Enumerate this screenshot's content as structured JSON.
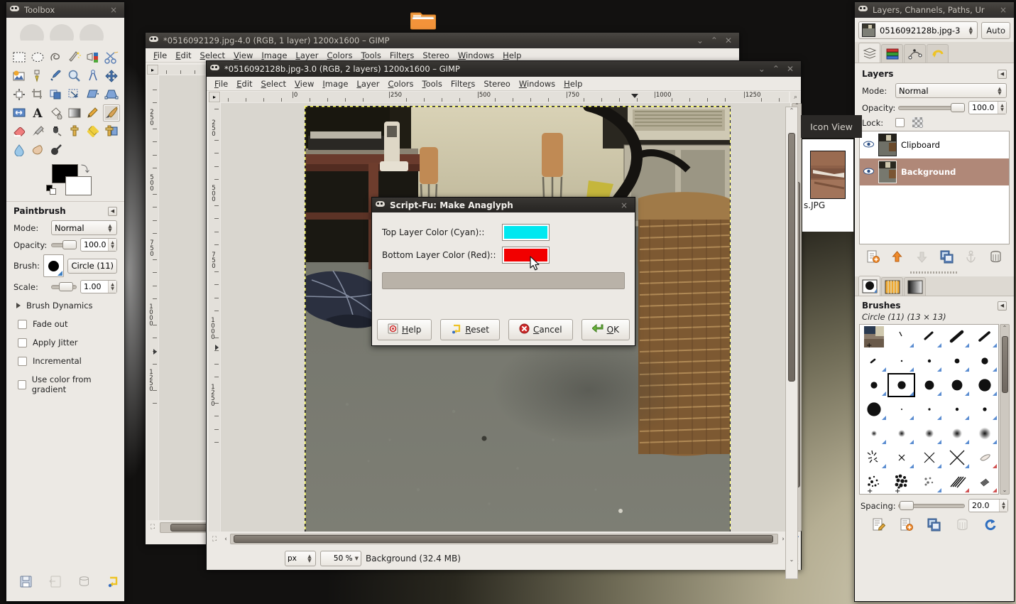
{
  "desktop": {
    "folder_icon": "folder-icon"
  },
  "toolbox": {
    "title": "Toolbox",
    "close_label": "×",
    "tools": [
      {
        "name": "rect-select-tool",
        "glyph": "rect-select"
      },
      {
        "name": "ellipse-select-tool",
        "glyph": "ellipse-select"
      },
      {
        "name": "free-select-tool",
        "glyph": "lasso"
      },
      {
        "name": "fuzzy-select-tool",
        "glyph": "wand"
      },
      {
        "name": "select-by-color-tool",
        "glyph": "bycolor"
      },
      {
        "name": "scissors-select-tool",
        "glyph": "scissors"
      },
      {
        "name": "foreground-select-tool",
        "glyph": "fgselect"
      },
      {
        "name": "paths-tool",
        "glyph": "path"
      },
      {
        "name": "color-picker-tool",
        "glyph": "picker"
      },
      {
        "name": "zoom-tool",
        "glyph": "zoom"
      },
      {
        "name": "measure-tool",
        "glyph": "measure"
      },
      {
        "name": "move-tool",
        "glyph": "move"
      },
      {
        "name": "alignment-tool",
        "glyph": "align"
      },
      {
        "name": "crop-tool",
        "glyph": "crop"
      },
      {
        "name": "rotate-tool",
        "glyph": "rotate"
      },
      {
        "name": "scale-tool",
        "glyph": "scale"
      },
      {
        "name": "shear-tool",
        "glyph": "shear"
      },
      {
        "name": "perspective-tool",
        "glyph": "perspective"
      },
      {
        "name": "flip-tool",
        "glyph": "flip"
      },
      {
        "name": "text-tool",
        "glyph": "text"
      },
      {
        "name": "bucket-fill-tool",
        "glyph": "bucket"
      },
      {
        "name": "gradient-tool",
        "glyph": "gradient"
      },
      {
        "name": "pencil-tool",
        "glyph": "pencil"
      },
      {
        "name": "paintbrush-tool",
        "glyph": "paintbrush",
        "selected": true
      },
      {
        "name": "eraser-tool",
        "glyph": "eraser"
      },
      {
        "name": "airbrush-tool",
        "glyph": "airbrush"
      },
      {
        "name": "ink-tool",
        "glyph": "ink"
      },
      {
        "name": "clone-tool",
        "glyph": "clone"
      },
      {
        "name": "heal-tool",
        "glyph": "heal"
      },
      {
        "name": "perspective-clone-tool",
        "glyph": "pclone"
      },
      {
        "name": "blur-sharpen-tool",
        "glyph": "blur"
      },
      {
        "name": "smudge-tool",
        "glyph": "smudge"
      },
      {
        "name": "dodge-burn-tool",
        "glyph": "dodge"
      }
    ],
    "colors": {
      "foreground": "#000000",
      "background": "#ffffff"
    },
    "options": {
      "header": "Paintbrush",
      "mode_label": "Mode:",
      "mode_value": "Normal",
      "opacity_label": "Opacity:",
      "opacity_value": "100.0",
      "brush_label": "Brush:",
      "brush_value": "Circle (11)",
      "scale_label": "Scale:",
      "scale_value": "1.00",
      "brush_dynamics": "Brush Dynamics",
      "checkboxes": [
        {
          "label": "Fade out",
          "checked": false
        },
        {
          "label": "Apply Jitter",
          "checked": false
        },
        {
          "label": "Incremental",
          "checked": false
        },
        {
          "label": "Use color from gradient",
          "checked": false
        }
      ]
    },
    "bottom_icons": [
      "save-tool-options-icon",
      "restore-tool-options-icon",
      "delete-tool-options-icon",
      "reset-tool-options-icon"
    ]
  },
  "image_window_back": {
    "title": "*0516092129.jpg-4.0 (RGB, 1 layer) 1200x1600 – GIMP",
    "menus": [
      "File",
      "Edit",
      "Select",
      "View",
      "Image",
      "Layer",
      "Colors",
      "Tools",
      "Filters",
      "Stereo",
      "Windows",
      "Help"
    ],
    "v_ruler_labels": [
      "250",
      "500",
      "750",
      "1000",
      "1250"
    ]
  },
  "image_window_front": {
    "title": "*0516092128b.jpg-3.0 (RGB, 2 layers) 1200x1600 – GIMP",
    "menus": [
      "File",
      "Edit",
      "Select",
      "View",
      "Image",
      "Layer",
      "Colors",
      "Tools",
      "Filters",
      "Stereo",
      "Windows",
      "Help"
    ],
    "h_ruler_labels": [
      "0",
      "250",
      "500",
      "750",
      "1000",
      "1250"
    ],
    "v_ruler_labels": [
      "250",
      "500",
      "750",
      "1000",
      "1250"
    ],
    "statusbar": {
      "unit": "px",
      "zoom": "50 %",
      "status_text": "Background (32.4 MB)"
    }
  },
  "iconview_popup": {
    "label": "Icon View",
    "file_label": "s.JPG"
  },
  "script_fu_dialog": {
    "title": "Script-Fu: Make Anaglyph",
    "close_label": "×",
    "fields": [
      {
        "label": "Top Layer Color (Cyan)::",
        "color": "#00e8f0",
        "name": "top-layer-color"
      },
      {
        "label": "Bottom Layer Color (Red)::",
        "color": "#f20000",
        "name": "bottom-layer-color"
      }
    ],
    "progress_value": 0,
    "buttons": [
      {
        "label": "Help",
        "accel": "H",
        "icon": "help-icon"
      },
      {
        "label": "Reset",
        "accel": "R",
        "icon": "reset-icon"
      },
      {
        "label": "Cancel",
        "accel": "C",
        "icon": "cancel-icon"
      },
      {
        "label": "OK",
        "accel": "O",
        "icon": "ok-icon"
      }
    ]
  },
  "dock": {
    "title": "Layers, Channels, Paths, Ur",
    "close_label": "×",
    "image_selector": {
      "value": "0516092128b.jpg-3",
      "auto_label": "Auto"
    },
    "tabs": [
      {
        "name": "layers-tab",
        "active": true
      },
      {
        "name": "channels-tab",
        "active": false
      },
      {
        "name": "paths-tab",
        "active": false
      },
      {
        "name": "undo-history-tab",
        "active": false
      }
    ],
    "layers_panel": {
      "header": "Layers",
      "mode_label": "Mode:",
      "mode_value": "Normal",
      "opacity_label": "Opacity:",
      "opacity_value": "100.0",
      "lock_label": "Lock:",
      "layers": [
        {
          "name": "Clipboard",
          "visible": true,
          "selected": false
        },
        {
          "name": "Background",
          "visible": true,
          "selected": true
        }
      ],
      "buttons": [
        "new-layer-icon",
        "raise-layer-icon",
        "lower-layer-icon",
        "duplicate-layer-icon",
        "anchor-layer-icon",
        "delete-layer-icon"
      ]
    },
    "brushes_panel": {
      "tabs": [
        "brushes-tab",
        "patterns-tab",
        "gradients-tab"
      ],
      "header": "Brushes",
      "selected_brush": "Circle (11) (13 × 13)",
      "spacing_label": "Spacing:",
      "spacing_value": "20.0",
      "buttons": [
        "edit-brush-icon",
        "new-brush-icon",
        "duplicate-brush-icon",
        "delete-brush-icon",
        "refresh-brushes-icon"
      ]
    }
  }
}
